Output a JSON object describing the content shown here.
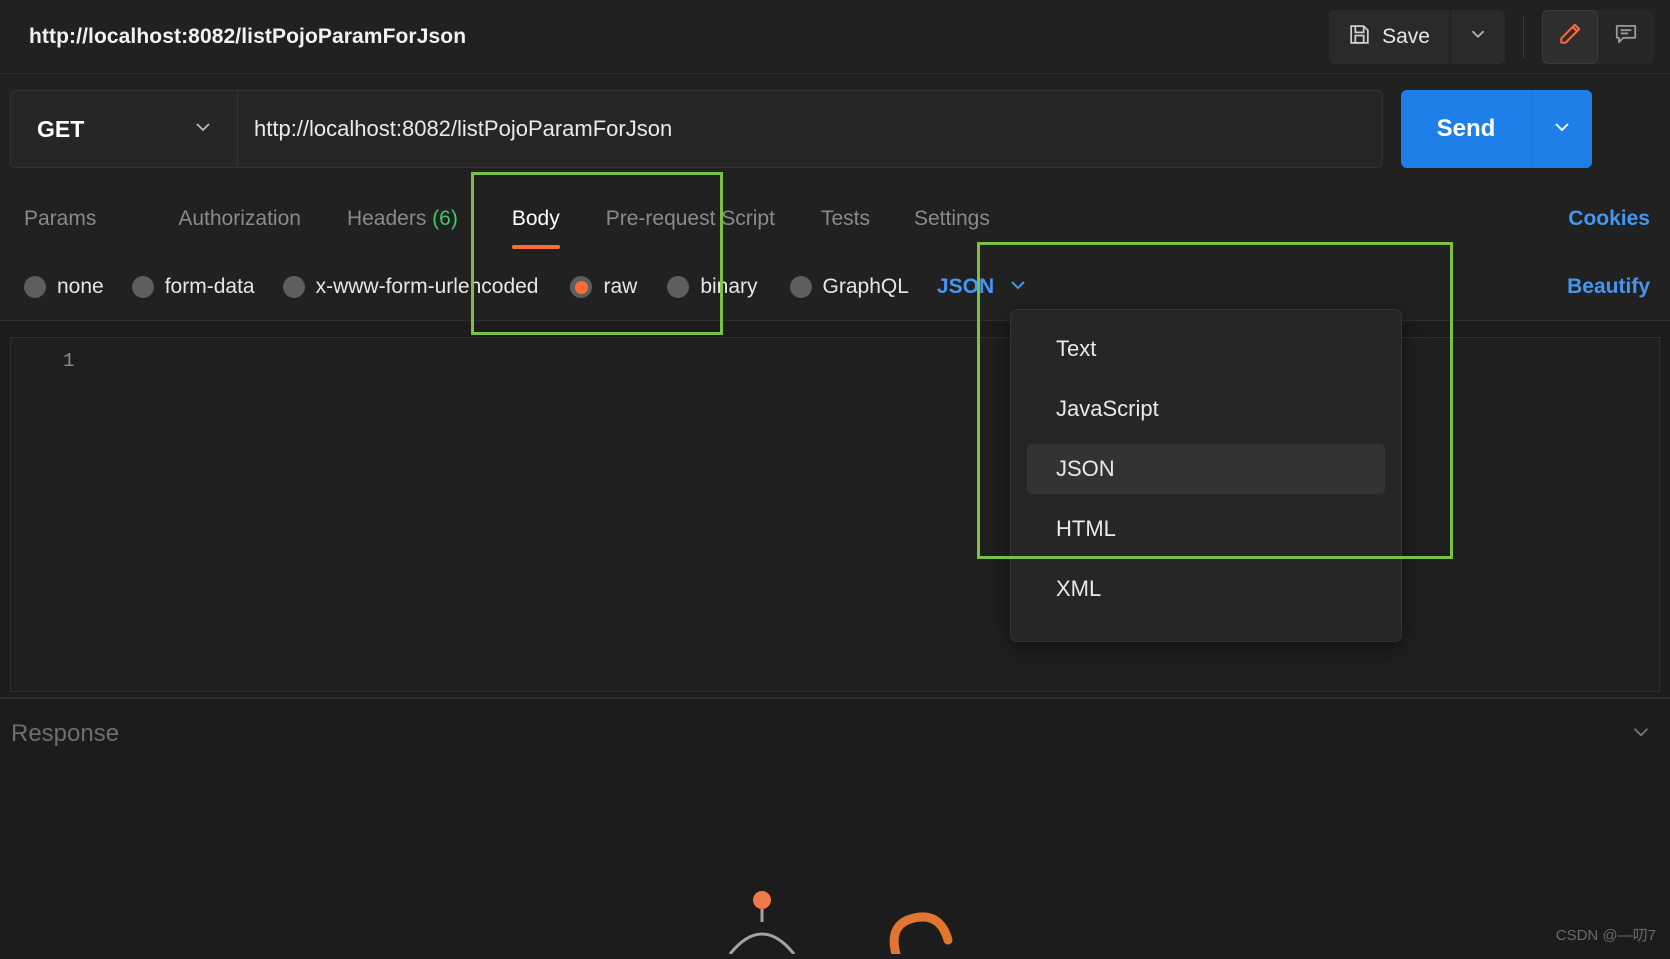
{
  "window": {
    "request_title": "http://localhost:8082/listPojoParamForJson"
  },
  "topbar": {
    "save_label": "Save",
    "save_icon": "floppy-disk-icon",
    "save_caret_icon": "chevron-down-icon",
    "edit_icon": "pencil-icon",
    "comment_icon": "comment-icon",
    "accent_orange": "#ff6c37"
  },
  "urlbar": {
    "method": "GET",
    "method_caret_icon": "chevron-down-icon",
    "url_value": "http://localhost:8082/listPojoParamForJson",
    "url_placeholder": "Enter request URL",
    "send_label": "Send",
    "send_caret_icon": "chevron-down-icon",
    "send_color": "#1f7fe8"
  },
  "tabs": [
    {
      "label": "Params",
      "active": false
    },
    {
      "label": "Authorization",
      "active": false
    },
    {
      "label": "Headers",
      "count": "(6)",
      "active": false
    },
    {
      "label": "Body",
      "active": true
    },
    {
      "label": "Pre-request Script",
      "active": false
    },
    {
      "label": "Tests",
      "active": false
    },
    {
      "label": "Settings",
      "active": false
    }
  ],
  "tabs_right": {
    "cookies_label": "Cookies",
    "link_color": "#4596f1"
  },
  "body_types": [
    {
      "label": "none",
      "selected": false
    },
    {
      "label": "form-data",
      "selected": false
    },
    {
      "label": "x-www-form-urlencoded",
      "selected": false
    },
    {
      "label": "raw",
      "selected": true
    },
    {
      "label": "binary",
      "selected": false
    },
    {
      "label": "GraphQL",
      "selected": false
    }
  ],
  "format_select": {
    "value": "JSON",
    "caret_icon": "chevron-down-icon",
    "options": [
      "Text",
      "JavaScript",
      "JSON",
      "HTML",
      "XML"
    ],
    "selected_option": "JSON"
  },
  "beautify": {
    "label": "Beautify"
  },
  "editor": {
    "line_numbers": [
      "1"
    ],
    "content": ""
  },
  "response": {
    "label": "Response",
    "caret_icon": "chevron-down-icon"
  },
  "annotations": {
    "color": "#7cc242",
    "boxes": [
      "body-tab-highlight",
      "format-dropdown-highlight"
    ]
  },
  "watermark": {
    "text": "CSDN @—叨7"
  }
}
